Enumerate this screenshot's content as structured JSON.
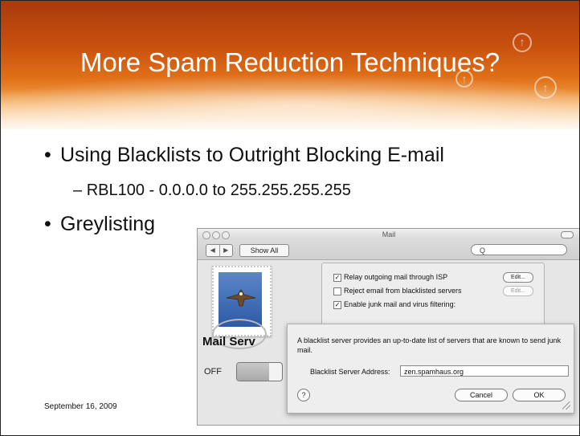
{
  "slide": {
    "title": "More Spam Reduction Techniques?",
    "bullets": [
      {
        "text": "Using Blacklists to Outright Blocking E-mail"
      },
      {
        "text": "Greylisting"
      }
    ],
    "sub_bullet": "RBL100 - 0.0.0.0 to 255.255.255.255",
    "footer_date": "September 16, 2009",
    "colors": {
      "banner_dark": "#a83a0c",
      "banner_light": "#f2a24a"
    }
  },
  "mail_window": {
    "title": "Mail",
    "toolbar": {
      "back_glyph": "◀",
      "forward_glyph": "▶",
      "show_all": "Show All",
      "search_glyph": "Q"
    },
    "service_name": "Mail Serv",
    "toggle_label": "OFF",
    "options": [
      {
        "checked": true,
        "label": "Relay outgoing mail through ISP",
        "edit": "Edit...",
        "edit_enabled": true
      },
      {
        "checked": false,
        "label": "Reject email from blacklisted servers",
        "edit": "Edit...",
        "edit_enabled": false
      },
      {
        "checked": true,
        "label": "Enable junk mail and virus filtering:"
      }
    ]
  },
  "sheet": {
    "message": "A blacklist server provides an up-to-date list of servers that are known to send junk mail.",
    "field_label": "Blacklist Server Address:",
    "field_value": "zen.spamhaus.org",
    "help": "?",
    "cancel": "Cancel",
    "ok": "OK"
  }
}
